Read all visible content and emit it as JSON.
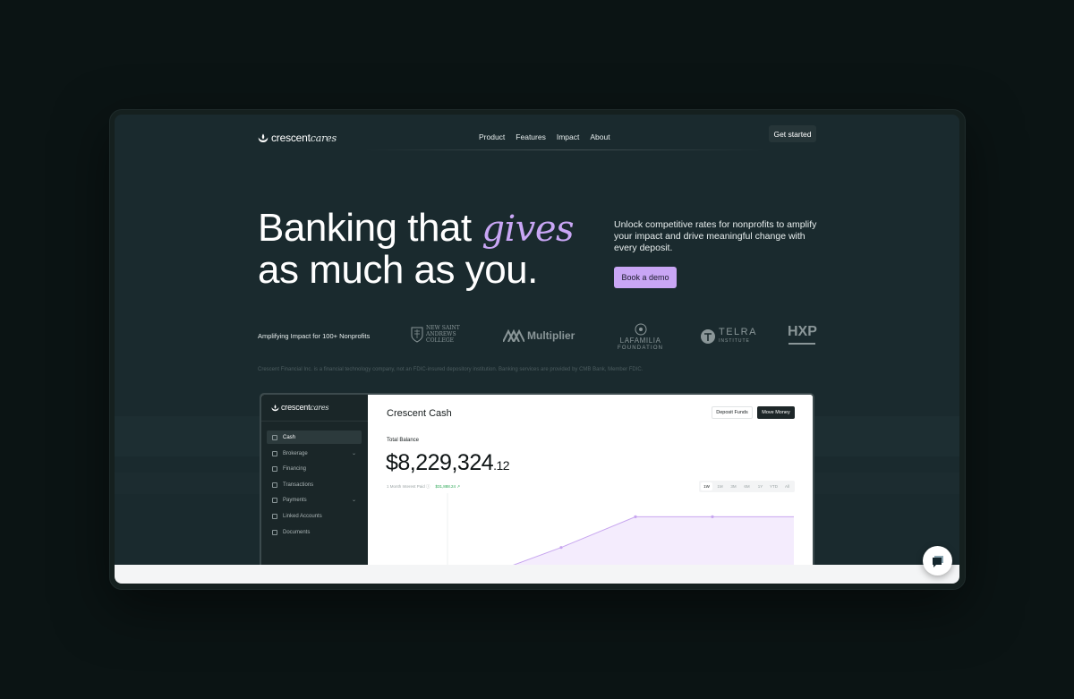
{
  "brand": {
    "name_plain": "crescent",
    "name_script": "cares"
  },
  "nav": {
    "links": [
      "Product",
      "Features",
      "Impact",
      "About"
    ],
    "cta": "Get started"
  },
  "hero": {
    "title_line1_start": "Banking that ",
    "title_accent": "gives",
    "title_line2": "as much as you.",
    "subtitle": "Unlock competitive rates for nonprofits to amplify your impact and drive meaningful change with every deposit.",
    "cta": "Book a demo"
  },
  "partners": {
    "label": "Amplifying Impact for 100+ Nonprofits",
    "logos": {
      "nsa_line1": "NEW SAINT",
      "nsa_line2": "ANDREWS",
      "nsa_line3": "COLLEGE",
      "multiplier": "Multiplier",
      "lafamilia_line1": "LAFAMILIA",
      "lafamilia_line2": "FOUNDATION",
      "telra": "TELRA",
      "telra_sub": "INSTITUTE",
      "hxp": "HXP"
    }
  },
  "disclaimer": "Crescent Financial Inc. is a financial technology company, not an FDIC-insured depository institution. Banking services are provided by CMB Bank, Member FDIC.",
  "app": {
    "sidebar": [
      {
        "label": "Cash",
        "icon": "cash-icon",
        "active": true
      },
      {
        "label": "Brokerage",
        "icon": "brokerage-icon",
        "chevron": true
      },
      {
        "label": "Financing",
        "icon": "financing-icon"
      },
      {
        "label": "Transactions",
        "icon": "transactions-icon"
      },
      {
        "label": "Payments",
        "icon": "payments-icon",
        "chevron": true
      },
      {
        "label": "Linked Accounts",
        "icon": "linked-accounts-icon"
      },
      {
        "label": "Documents",
        "icon": "documents-icon"
      }
    ],
    "title": "Crescent Cash",
    "deposit_btn": "Deposit Funds",
    "move_btn": "Move Money",
    "balance_label": "Total Balance",
    "balance_main": "$8,229,324",
    "balance_cents": ".12",
    "interest_label": "1 Month Interest Paid ⓘ",
    "interest_value": "$31,888.24 ↗",
    "ranges": [
      "1W",
      "1M",
      "3M",
      "6M",
      "1Y",
      "YTD",
      "All"
    ],
    "active_range": "1W",
    "colors": {
      "line": "#c7a5ef",
      "fill": "#f4ecfd"
    }
  },
  "chart_data": {
    "type": "area",
    "values": [
      0,
      0.08,
      0.48,
      0.86,
      0.86,
      0.86
    ]
  }
}
